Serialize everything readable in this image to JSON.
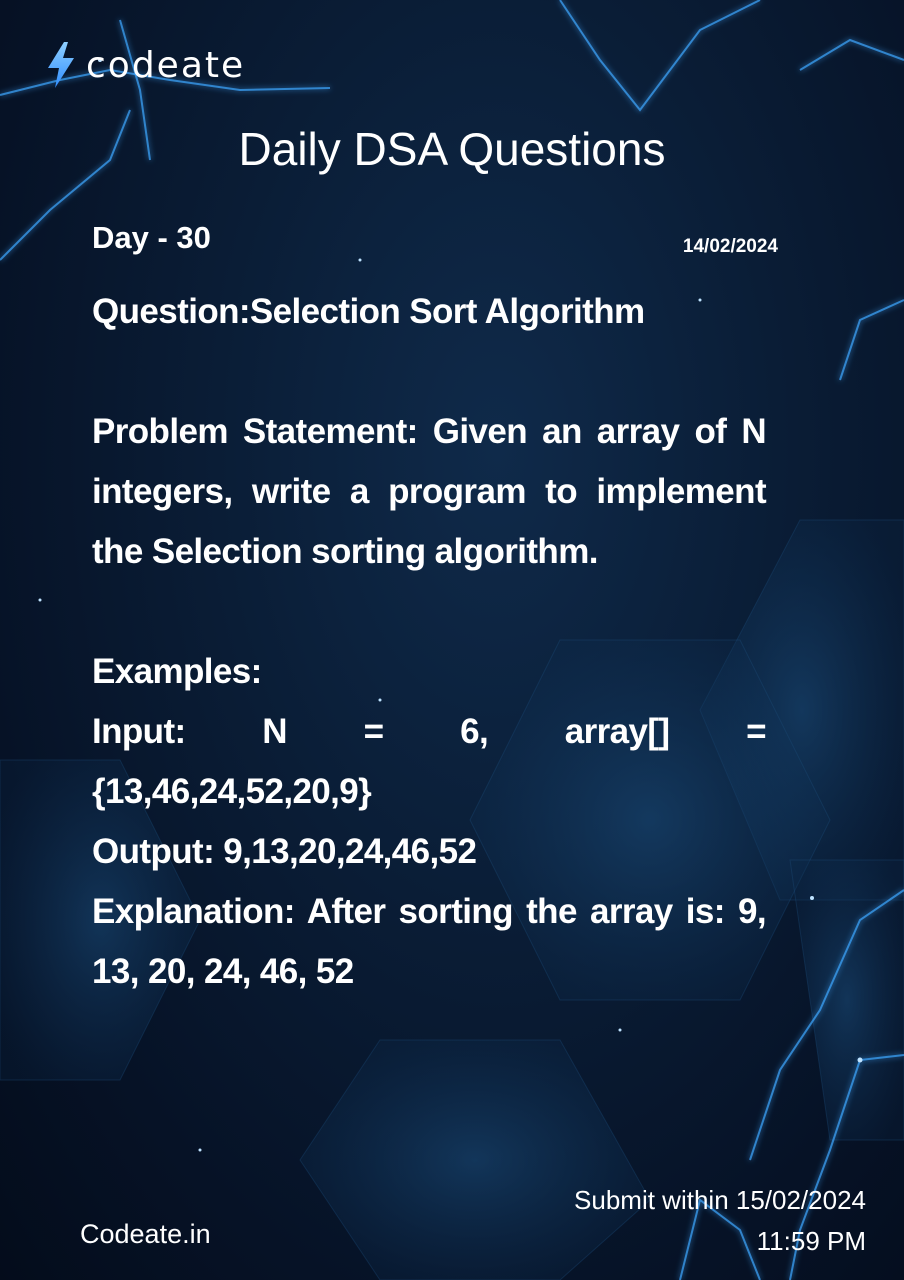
{
  "brand": {
    "name": "codeate",
    "icon": "lightning-bolt-icon",
    "accent_color": "#3fa6ff"
  },
  "header": {
    "title": "Daily DSA Questions",
    "day": "Day - 30",
    "date": "14/02/2024"
  },
  "question": {
    "title": "Question:Selection Sort Algorithm",
    "problem_statement": "Problem Statement: Given an array of N integers, write a program to implement the Selection sorting algorithm."
  },
  "examples": {
    "heading": "Examples:",
    "input_tokens": [
      "Input:",
      "N",
      "=",
      "6,",
      "array[]",
      "="
    ],
    "input_array": "{13,46,24,52,20,9}",
    "output": "Output: 9,13,20,24,46,52",
    "explanation": "Explanation: After sorting the array is: 9, 13, 20, 24, 46, 52"
  },
  "footer": {
    "website": "Codeate.in",
    "submit_line1": "Submit within 15/02/2024",
    "submit_line2": "11:59 PM"
  },
  "colors": {
    "background": "#0a1d36",
    "text": "#ffffff",
    "glow": "#3fa6ff"
  }
}
